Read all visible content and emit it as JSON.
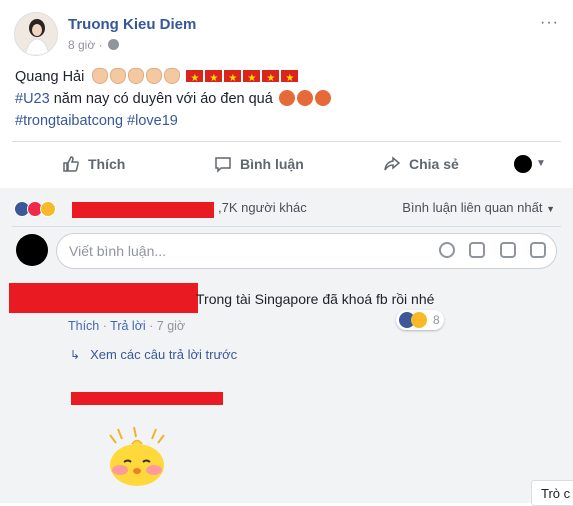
{
  "post": {
    "author": "Truong Kieu Diem",
    "time": "8 giờ",
    "more": "···",
    "content": {
      "line1_text": "Quang Hải",
      "line2_hashtag": "#U23",
      "line2_text": " năm nay có duyên với áo đen quá",
      "line3_hashtags": "#trongtaibatcong #love19"
    }
  },
  "actions": {
    "like": "Thích",
    "comment": "Bình luận",
    "share": "Chia sẻ"
  },
  "reactions": {
    "count_text": ",7K người khác",
    "sort": "Bình luận liên quan nhất"
  },
  "composer": {
    "placeholder": "Viết bình luận..."
  },
  "comment": {
    "text": "Trong tài Singapore đã khoá fb rồi nhé",
    "reaction_count": "8",
    "like": "Thích",
    "sep1": " · ",
    "reply": "Trả lời",
    "sep2": " · ",
    "time": "7 giờ"
  },
  "previous_replies": "Xem các câu trả lời trước",
  "chat_label": "Trò c",
  "colors": {
    "link": "#365899",
    "redaction": "#ea1a22",
    "grey_bg": "#f2f3f5"
  }
}
